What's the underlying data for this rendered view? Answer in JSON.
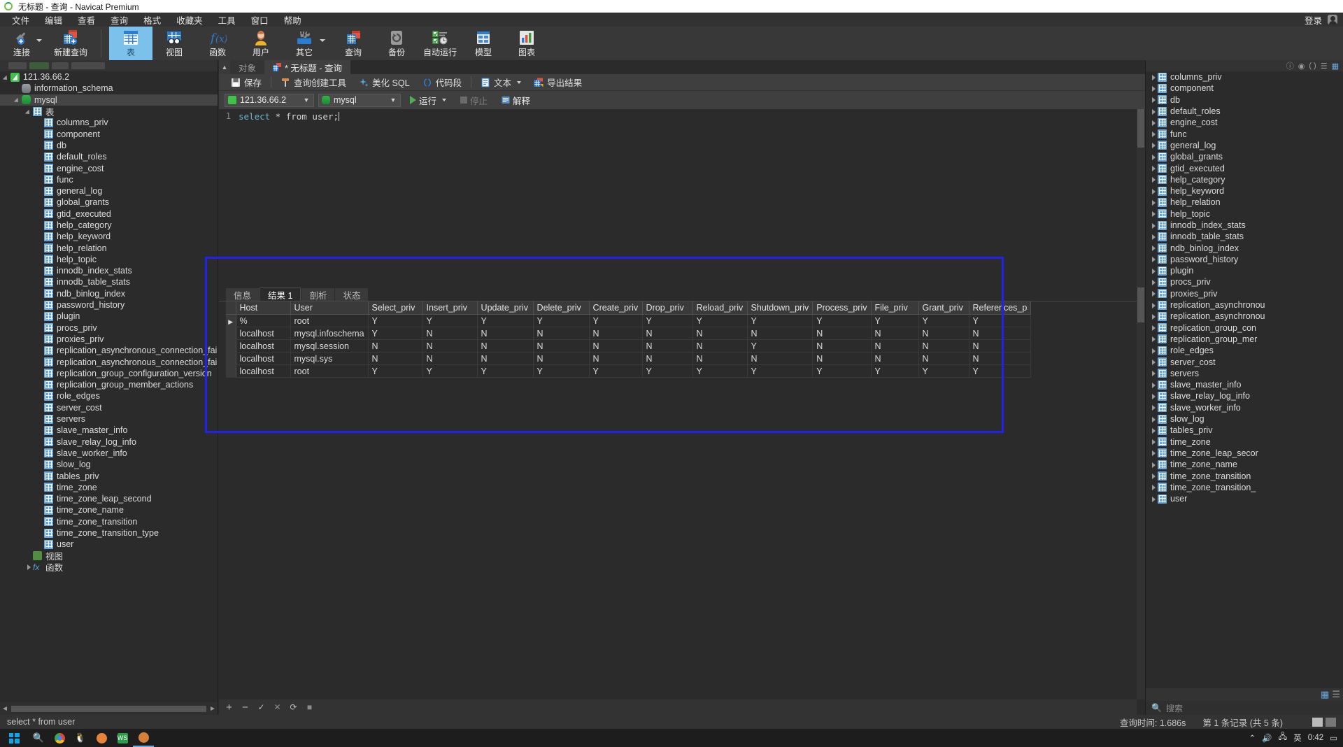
{
  "window": {
    "title": "无标题 - 查询 - Navicat Premium",
    "login_label": "登录"
  },
  "menu": {
    "items": [
      "文件",
      "编辑",
      "查看",
      "查询",
      "格式",
      "收藏夹",
      "工具",
      "窗口",
      "帮助"
    ]
  },
  "ribbon": {
    "items": [
      {
        "label": "连接",
        "icon": "connection-icon",
        "has_caret": true,
        "active": false
      },
      {
        "label": "新建查询",
        "icon": "new-query-icon",
        "has_caret": false,
        "active": false
      },
      {
        "label": "表",
        "icon": "table-icon",
        "has_caret": false,
        "active": true
      },
      {
        "label": "视图",
        "icon": "view-icon",
        "has_caret": false,
        "active": false
      },
      {
        "label": "函数",
        "icon": "function-icon",
        "has_caret": false,
        "active": false
      },
      {
        "label": "用户",
        "icon": "user-icon",
        "has_caret": false,
        "active": false
      },
      {
        "label": "其它",
        "icon": "other-tools-icon",
        "has_caret": true,
        "active": false
      },
      {
        "label": "查询",
        "icon": "query-icon",
        "has_caret": false,
        "active": false
      },
      {
        "label": "备份",
        "icon": "backup-icon",
        "has_caret": false,
        "active": false
      },
      {
        "label": "自动运行",
        "icon": "automation-icon",
        "has_caret": false,
        "active": false
      },
      {
        "label": "模型",
        "icon": "model-icon",
        "has_caret": false,
        "active": false
      },
      {
        "label": "图表",
        "icon": "chart-icon",
        "has_caret": false,
        "active": false
      }
    ]
  },
  "sidebar": {
    "connection": "121.36.66.2",
    "databases": [
      {
        "name": "information_schema",
        "icon": "database-icon-grey",
        "expanded": false,
        "indent": 1
      },
      {
        "name": "mysql",
        "icon": "database-icon-green",
        "expanded": true,
        "indent": 1,
        "selected": true
      }
    ],
    "tables_folder": "表",
    "views_folder": "视图",
    "functions_folder": "函数",
    "tables": [
      "columns_priv",
      "component",
      "db",
      "default_roles",
      "engine_cost",
      "func",
      "general_log",
      "global_grants",
      "gtid_executed",
      "help_category",
      "help_keyword",
      "help_relation",
      "help_topic",
      "innodb_index_stats",
      "innodb_table_stats",
      "ndb_binlog_index",
      "password_history",
      "plugin",
      "procs_priv",
      "proxies_priv",
      "replication_asynchronous_connection_failover",
      "replication_asynchronous_connection_failover_managed",
      "replication_group_configuration_version",
      "replication_group_member_actions",
      "role_edges",
      "server_cost",
      "servers",
      "slave_master_info",
      "slave_relay_log_info",
      "slave_worker_info",
      "slow_log",
      "tables_priv",
      "time_zone",
      "time_zone_leap_second",
      "time_zone_name",
      "time_zone_transition",
      "time_zone_transition_type",
      "user"
    ]
  },
  "editor_tabs": [
    {
      "label": "对象",
      "active": false,
      "icon": ""
    },
    {
      "label": "* 无标题 - 查询",
      "active": true,
      "icon": "query-tab-icon"
    }
  ],
  "query_toolbar": {
    "save": "保存",
    "query_builder": "查询创建工具",
    "beautify_sql": "美化 SQL",
    "snippets": "代码段",
    "text": "文本",
    "export_result": "导出结果"
  },
  "conn_bar": {
    "connection": "121.36.66.2",
    "database": "mysql",
    "run": "运行",
    "stop": "停止",
    "explain": "解释"
  },
  "sql_editor": {
    "line_number": "1",
    "keyword": "select",
    "rest": " * from user;"
  },
  "result_tabs": [
    {
      "label": "信息",
      "active": false
    },
    {
      "label": "结果 1",
      "active": true
    },
    {
      "label": "剖析",
      "active": false
    },
    {
      "label": "状态",
      "active": false
    }
  ],
  "result_grid": {
    "columns": [
      "Host",
      "User",
      "Select_priv",
      "Insert_priv",
      "Update_priv",
      "Delete_priv",
      "Create_priv",
      "Drop_priv",
      "Reload_priv",
      "Shutdown_priv",
      "Process_priv",
      "File_priv",
      "Grant_priv",
      "References_p"
    ],
    "rows": [
      {
        "current": true,
        "cells": [
          "%",
          "root",
          "Y",
          "Y",
          "Y",
          "Y",
          "Y",
          "Y",
          "Y",
          "Y",
          "Y",
          "Y",
          "Y",
          "Y"
        ]
      },
      {
        "current": false,
        "cells": [
          "localhost",
          "mysql.infoschema",
          "Y",
          "N",
          "N",
          "N",
          "N",
          "N",
          "N",
          "N",
          "N",
          "N",
          "N",
          "N"
        ]
      },
      {
        "current": false,
        "cells": [
          "localhost",
          "mysql.session",
          "N",
          "N",
          "N",
          "N",
          "N",
          "N",
          "N",
          "Y",
          "N",
          "N",
          "N",
          "N"
        ]
      },
      {
        "current": false,
        "cells": [
          "localhost",
          "mysql.sys",
          "N",
          "N",
          "N",
          "N",
          "N",
          "N",
          "N",
          "N",
          "N",
          "N",
          "N",
          "N"
        ]
      },
      {
        "current": false,
        "cells": [
          "localhost",
          "root",
          "Y",
          "Y",
          "Y",
          "Y",
          "Y",
          "Y",
          "Y",
          "Y",
          "Y",
          "Y",
          "Y",
          "Y"
        ]
      }
    ]
  },
  "right_panel": {
    "search_placeholder": "搜索",
    "items": [
      "columns_priv",
      "component",
      "db",
      "default_roles",
      "engine_cost",
      "func",
      "general_log",
      "global_grants",
      "gtid_executed",
      "help_category",
      "help_keyword",
      "help_relation",
      "help_topic",
      "innodb_index_stats",
      "innodb_table_stats",
      "ndb_binlog_index",
      "password_history",
      "plugin",
      "procs_priv",
      "proxies_priv",
      "replication_asynchronou",
      "replication_asynchronou",
      "replication_group_con",
      "replication_group_mer",
      "role_edges",
      "server_cost",
      "servers",
      "slave_master_info",
      "slave_relay_log_info",
      "slave_worker_info",
      "slow_log",
      "tables_priv",
      "time_zone",
      "time_zone_leap_secor",
      "time_zone_name",
      "time_zone_transition",
      "time_zone_transition_",
      "user"
    ]
  },
  "statusbar": {
    "query_text": "select * from user",
    "duration": "查询时间: 1.686s",
    "record_info": "第 1 条记录 (共 5 条)"
  },
  "taskbar": {
    "time": "0:42",
    "ime": "英"
  },
  "colors": {
    "accent": "#2b7dd1",
    "active_tab": "#7cc0ec",
    "highlight_box": "#2222ee",
    "panel_bg": "#2b2b2b",
    "toolbar_bg": "#383838"
  }
}
